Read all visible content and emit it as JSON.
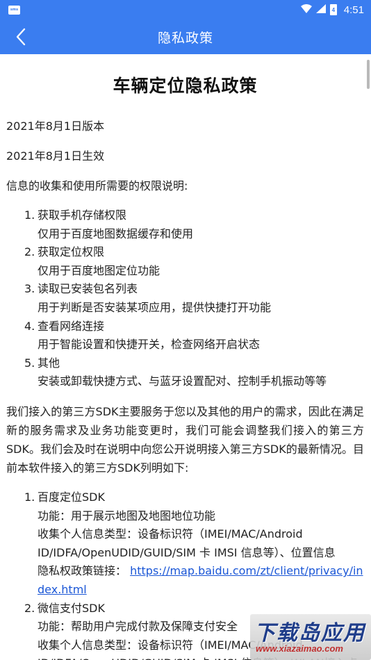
{
  "status_bar": {
    "time": "4:51",
    "battery": "4",
    "sms_label": "sms"
  },
  "app_bar": {
    "title": "隐私政策"
  },
  "document": {
    "title": "车辆定位隐私政策",
    "version_line": "2021年8月1日版本",
    "effective_line": "2021年8月1日生效",
    "permissions_intro": "信息的收集和使用所需要的权限说明:",
    "permissions": [
      {
        "num": "1.",
        "title": "获取手机存储权限",
        "desc": "仅用于百度地图数据缓存和使用"
      },
      {
        "num": "2.",
        "title": "获取定位权限",
        "desc": "仅用于百度地图定位功能"
      },
      {
        "num": "3.",
        "title": "读取已安装包名列表",
        "desc": "用于判断是否安装某项应用，提供快捷打开功能"
      },
      {
        "num": "4.",
        "title": "查看网络连接",
        "desc": "用于智能设置和快捷开关，检查网络开启状态"
      },
      {
        "num": "5.",
        "title": "其他",
        "desc": "安装或卸载快捷方式、与蓝牙设置配对、控制手机振动等等"
      }
    ],
    "sdk_paragraph": "我们接入的第三方SDK主要服务于您以及其他的用户的需求，因此在满足新的服务需求及业务功能变更时，我们可能会调整我们接入的第三方SDK。我们会及时在说明中向您公开说明接入第三方SDK的最新情况。目前本软件接入的第三方SDK列明如下:",
    "sdks": [
      {
        "num": "1.",
        "name": "百度定位SDK",
        "function": "功能：用于展示地图及地图地位功能",
        "info_type": "收集个人信息类型：设备标识符（IMEI/MAC/Android ID/IDFA/OpenUDID/GUID/SIM 卡 IMSI 信息等）、位置信息",
        "policy_label": "隐私权政策链接：",
        "policy_link": "https://map.baidu.com/zt/client/privacy/index.html"
      },
      {
        "num": "2.",
        "name": "微信支付SDK",
        "function": "功能：帮助用户完成付款及保障支付安全",
        "info_type": "收集个人信息类型：设备标识符（IMEI/MAC/Android ID/IDFA/OpenUDID/GUID/SIM 卡 IMSI 信息等）、WLAN接入点"
      }
    ]
  },
  "watermark": {
    "text": "下载岛应用",
    "url": "www.xiazaimao.com"
  },
  "colors": {
    "accent": "#3a7df0",
    "link": "#1a56d6"
  }
}
